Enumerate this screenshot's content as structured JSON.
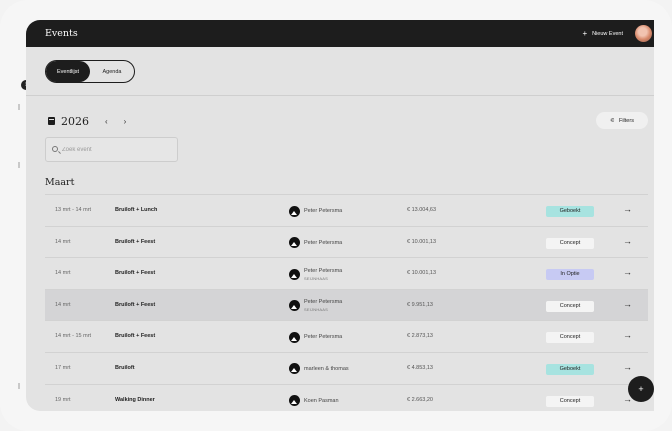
{
  "header": {
    "title": "Events",
    "new_event_label": "Nieuw Event"
  },
  "tabs": [
    {
      "label": "Eventlijst",
      "active": true
    },
    {
      "label": "Agenda",
      "active": false
    }
  ],
  "toolbar": {
    "year": "2026",
    "prev_icon": "chevron-left-icon",
    "next_icon": "chevron-right-icon",
    "filters_label": "Filters"
  },
  "search": {
    "placeholder": "Zoek event",
    "value": ""
  },
  "month": "Maart",
  "rows": [
    {
      "date": "13 mrt - 14 mrt",
      "name": "Bruiloft + Lunch",
      "person": "Peter Petersma",
      "sub": "",
      "amount": "€ 13.004,63",
      "status": "Geboekt",
      "status_type": "geboekt"
    },
    {
      "date": "14 mrt",
      "name": "Bruiloft + Feest",
      "person": "Peter Petersma",
      "sub": "",
      "amount": "€ 10.001,13",
      "status": "Concept",
      "status_type": "concept"
    },
    {
      "date": "14 mrt",
      "name": "Bruiloft + Feest",
      "person": "Peter Petersma",
      "sub": "SEIJNHAAS",
      "amount": "€ 10.001,13",
      "status": "In Optie",
      "status_type": "optie"
    },
    {
      "date": "14 mrt",
      "name": "Bruiloft + Feest",
      "person": "Peter Petersma",
      "sub": "SEIJNHAAS",
      "amount": "€ 9.951,13",
      "status": "Concept",
      "status_type": "concept"
    },
    {
      "date": "14 mrt - 15 mrt",
      "name": "Bruiloft + Feest",
      "person": "Peter Petersma",
      "sub": "",
      "amount": "€ 2.873,13",
      "status": "Concept",
      "status_type": "concept"
    },
    {
      "date": "17 mrt",
      "name": "Bruiloft",
      "person": "marleen & thomas",
      "sub": "",
      "amount": "€ 4.853,13",
      "status": "Geboekt",
      "status_type": "geboekt"
    },
    {
      "date": "19 mrt",
      "name": "Walking Dinner",
      "person": "Koen Pasman",
      "sub": "",
      "amount": "€ 2.663,20",
      "status": "Concept",
      "status_type": "concept"
    }
  ],
  "colors": {
    "topbar": "#1d1d1d",
    "geboekt": "#a7e3e0",
    "in_optie": "#c7caf3",
    "concept": "#f4f4f4"
  }
}
